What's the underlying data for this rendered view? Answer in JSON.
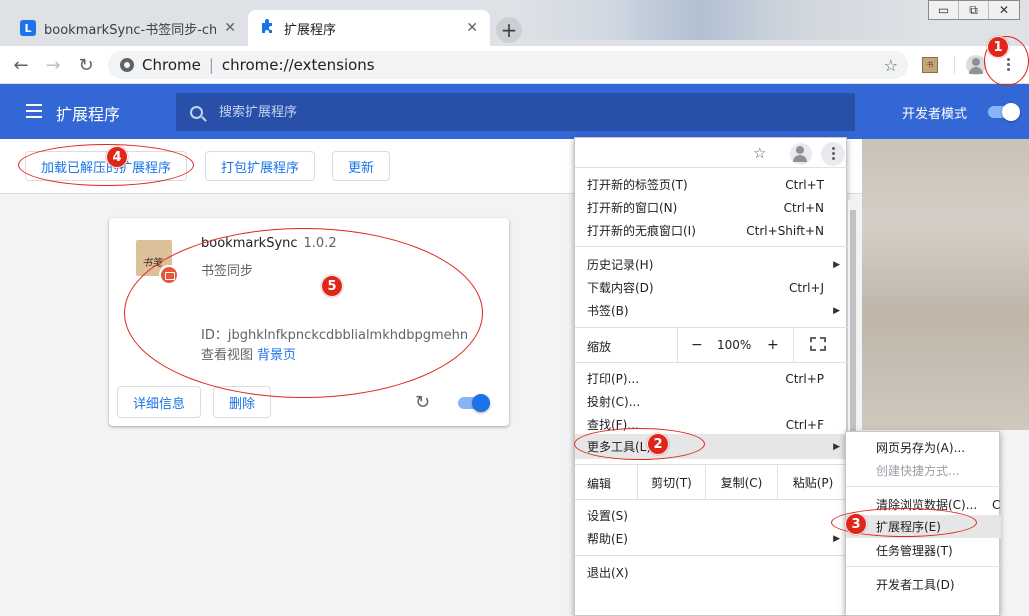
{
  "browser": {
    "tabs": [
      {
        "title": "bookmarkSync-书签同步-chrom",
        "favicon": "L",
        "active": false
      },
      {
        "title": "扩展程序",
        "favicon": "puzzle-icon",
        "active": true
      }
    ],
    "new_tab_label": "+",
    "window_controls": {
      "minimize": "▭",
      "restore": "⧉",
      "close": "✕"
    },
    "omnibox": {
      "site_label": "Chrome",
      "separator": "|",
      "url": "chrome://extensions"
    }
  },
  "extensions_page": {
    "header": {
      "title": "扩展程序",
      "search_placeholder": "搜索扩展程序",
      "developer_mode_label": "开发者模式",
      "developer_mode_on": true
    },
    "actions": {
      "load_unpacked": "加载已解压的扩展程序",
      "pack": "打包扩展程序",
      "update": "更新"
    },
    "card": {
      "name": "bookmarkSync",
      "version": "1.0.2",
      "description": "书签同步",
      "id_line": "ID：jbghklnfkpnckcdbblialmkhdbpgmehn",
      "views_label": "查看视图",
      "views_link": "背景页",
      "details_button": "详细信息",
      "remove_button": "删除",
      "enabled": true
    }
  },
  "main_menu": {
    "items_group1": [
      {
        "label": "打开新的标签页(T)",
        "shortcut": "Ctrl+T"
      },
      {
        "label": "打开新的窗口(N)",
        "shortcut": "Ctrl+N"
      },
      {
        "label": "打开新的无痕窗口(I)",
        "shortcut": "Ctrl+Shift+N"
      }
    ],
    "items_group2": [
      {
        "label": "历史记录(H)",
        "shortcut": "",
        "submenu": true
      },
      {
        "label": "下载内容(D)",
        "shortcut": "Ctrl+J",
        "submenu": false
      },
      {
        "label": "书签(B)",
        "shortcut": "",
        "submenu": true
      }
    ],
    "zoom": {
      "label": "缩放",
      "minus": "−",
      "value": "100%",
      "plus": "+"
    },
    "items_group3": [
      {
        "label": "打印(P)...",
        "shortcut": "Ctrl+P"
      },
      {
        "label": "投射(C)...",
        "shortcut": ""
      },
      {
        "label": "查找(F)...",
        "shortcut": "Ctrl+F"
      }
    ],
    "more_tools": "更多工具(L)",
    "edit": {
      "label": "编辑",
      "cut": "剪切(T)",
      "copy": "复制(C)",
      "paste": "粘贴(P)"
    },
    "settings": "设置(S)",
    "help": "帮助(E)",
    "exit": "退出(X)"
  },
  "more_tools_submenu": {
    "save_page": "网页另存为(A)...",
    "create_shortcut": "创建快捷方式...",
    "clear_data": "清除浏览数据(C)...",
    "clear_data_shortcut_partial": "C",
    "extensions": "扩展程序(E)",
    "task_manager": "任务管理器(T)",
    "dev_tools": "开发者工具(D)"
  },
  "annotations": [
    "1",
    "2",
    "3",
    "4",
    "5"
  ],
  "colors": {
    "accent": "#3367d6",
    "link": "#1a73e8",
    "annotation": "#e0261b"
  }
}
